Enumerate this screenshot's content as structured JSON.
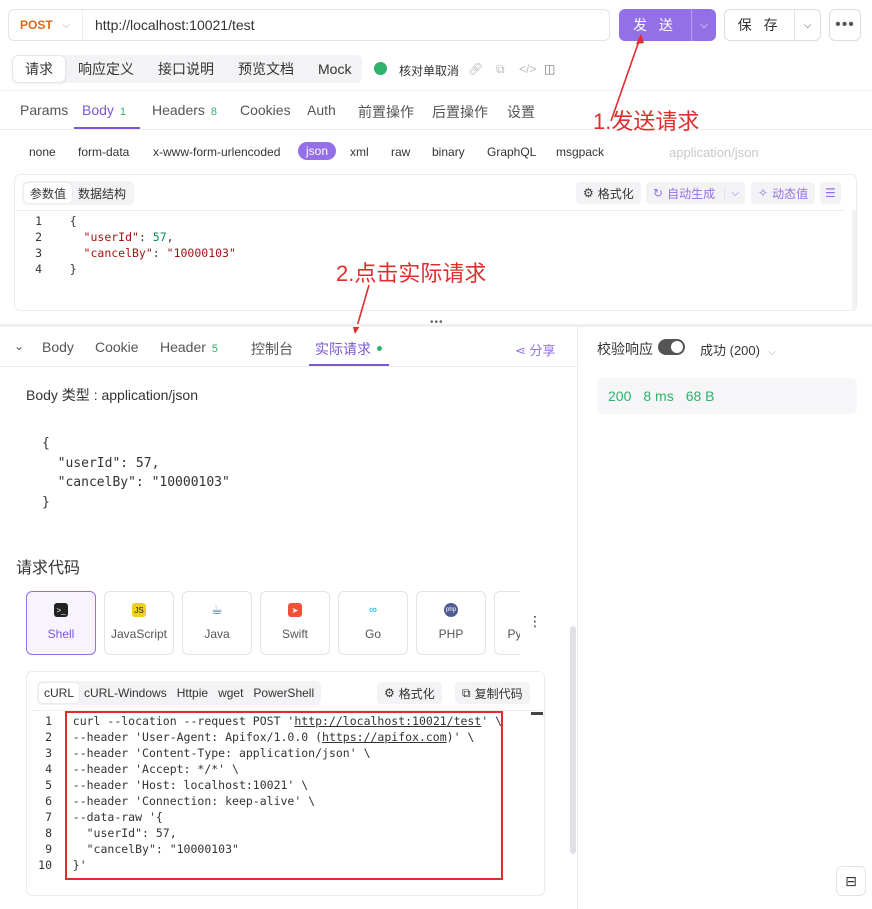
{
  "request": {
    "method": "POST",
    "url": "http://localhost:10021/test",
    "send_label": "发 送",
    "save_label": "保 存"
  },
  "doc_tabs": [
    "请求",
    "响应定义",
    "接口说明",
    "预览文档",
    "Mock"
  ],
  "endpoint_name": "核对单取消",
  "param_tabs": {
    "params": "Params",
    "body": "Body",
    "body_count": "1",
    "headers": "Headers",
    "headers_count": "8",
    "cookies": "Cookies",
    "auth": "Auth",
    "pre": "前置操作",
    "post": "后置操作",
    "settings": "设置"
  },
  "body_types": [
    "none",
    "form-data",
    "x-www-form-urlencoded",
    "json",
    "xml",
    "raw",
    "binary",
    "GraphQL",
    "msgpack"
  ],
  "content_type_placeholder": "application/json",
  "editor": {
    "tab_values": "参数值",
    "tab_schema": "数据结构",
    "format": "格式化",
    "auto_generate": "自动生成",
    "dynamic_value": "动态值",
    "lines": [
      {
        "n": "1",
        "text": "{"
      },
      {
        "n": "2",
        "key": "\"userId\"",
        "sep": ": ",
        "val": "57",
        "tail": ","
      },
      {
        "n": "3",
        "key": "\"cancelBy\"",
        "sep": ": ",
        "sval": "\"10000103\"",
        "tail": ""
      },
      {
        "n": "4",
        "text": "}"
      }
    ]
  },
  "annotations": {
    "step1": "1.发送请求",
    "step2": "2.点击实际请求"
  },
  "response_tabs": {
    "body": "Body",
    "cookie": "Cookie",
    "header": "Header",
    "header_count": "5",
    "console": "控制台",
    "actual": "实际请求",
    "share": "分享"
  },
  "actual_request": {
    "body_type_label": "Body 类型 : application/json",
    "body_lines": [
      "{",
      "  \"userId\": 57,",
      "  \"cancelBy\": \"10000103\"",
      "}"
    ],
    "code_title": "请求代码"
  },
  "languages": [
    "Shell",
    "JavaScript",
    "Java",
    "Swift",
    "Go",
    "PHP",
    "Py"
  ],
  "code_tabs": [
    "cURL",
    "cURL-Windows",
    "Httpie",
    "wget",
    "PowerShell"
  ],
  "code_buttons": {
    "format": "格式化",
    "copy": "复制代码"
  },
  "curl_lines": [
    {
      "n": "1",
      "a": "curl --location --request POST '",
      "u": "http://localhost:10021/test",
      "b": "' \\"
    },
    {
      "n": "2",
      "a": "--header 'User-Agent: Apifox/1.0.0 (",
      "u": "https://apifox.com",
      "b": ")' \\"
    },
    {
      "n": "3",
      "a": "--header 'Content-Type: application/json' \\"
    },
    {
      "n": "4",
      "a": "--header 'Accept: */*' \\"
    },
    {
      "n": "5",
      "a": "--header 'Host: localhost:10021' \\"
    },
    {
      "n": "6",
      "a": "--header 'Connection: keep-alive' \\"
    },
    {
      "n": "7",
      "a": "--data-raw '{"
    },
    {
      "n": "8",
      "a": "  \"userId\": 57,"
    },
    {
      "n": "9",
      "a": "  \"cancelBy\": \"10000103\""
    },
    {
      "n": "10",
      "a": "}'"
    }
  ],
  "validation": {
    "label": "校验响应",
    "status": "成功 (200)",
    "code": "200",
    "time": "8 ms",
    "size": "68 B"
  }
}
